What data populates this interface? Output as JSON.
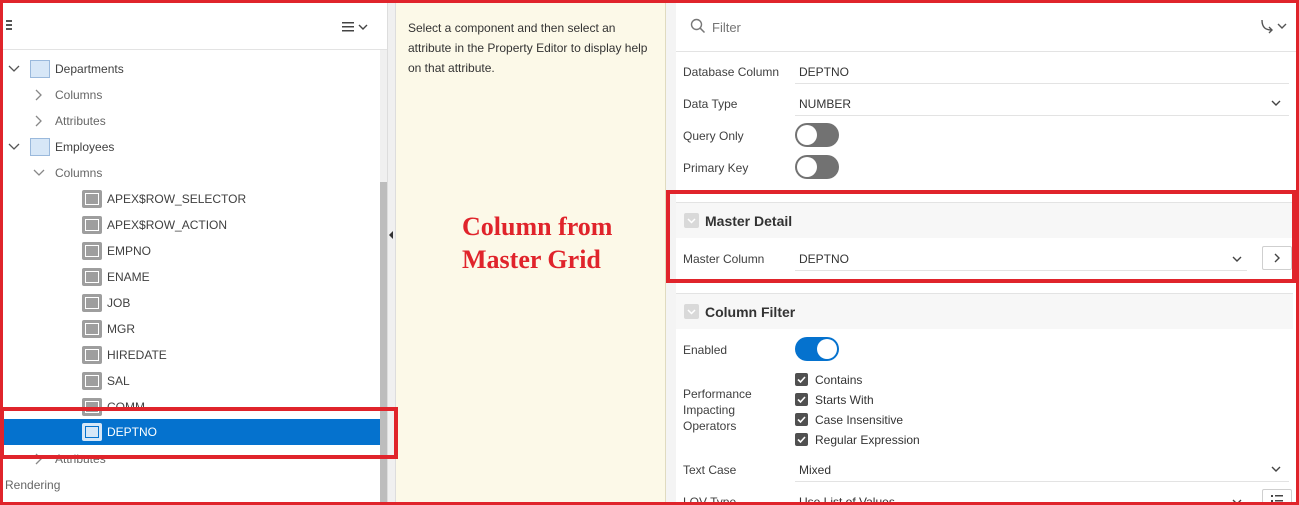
{
  "tree": {
    "items": [
      {
        "label": "Departments"
      },
      {
        "label": "Columns"
      },
      {
        "label": "Attributes"
      },
      {
        "label": "Employees"
      },
      {
        "label": "Columns"
      },
      {
        "label": "APEX$ROW_SELECTOR"
      },
      {
        "label": "APEX$ROW_ACTION"
      },
      {
        "label": "EMPNO"
      },
      {
        "label": "ENAME"
      },
      {
        "label": "JOB"
      },
      {
        "label": "MGR"
      },
      {
        "label": "HIREDATE"
      },
      {
        "label": "SAL"
      },
      {
        "label": "COMM"
      },
      {
        "label": "DEPTNO"
      },
      {
        "label": "Attributes"
      },
      {
        "label": "Rendering"
      }
    ],
    "selected": "DEPTNO"
  },
  "help": {
    "text": "Select a component and then select an attribute in the Property Editor to display help on that attribute."
  },
  "annotation": {
    "line1": "Column from",
    "line2": "Master Grid"
  },
  "property_editor": {
    "filter_placeholder": "Filter",
    "column": {
      "database_column_label": "Database Column",
      "database_column_value": "DEPTNO",
      "data_type_label": "Data Type",
      "data_type_value": "NUMBER",
      "query_only_label": "Query Only",
      "query_only_on": false,
      "primary_key_label": "Primary Key",
      "primary_key_on": false
    },
    "master_detail": {
      "title": "Master Detail",
      "master_column_label": "Master Column",
      "master_column_value": "DEPTNO"
    },
    "column_filter": {
      "title": "Column Filter",
      "enabled_label": "Enabled",
      "enabled_on": true,
      "perf_label_1": "Performance",
      "perf_label_2": "Impacting",
      "perf_label_3": "Operators",
      "operators": [
        "Contains",
        "Starts With",
        "Case Insensitive",
        "Regular Expression"
      ],
      "text_case_label": "Text Case",
      "text_case_value": "Mixed",
      "lov_type_label": "LOV Type",
      "lov_type_value": "Use List of Values"
    }
  },
  "colors": {
    "selection": "#0572ce",
    "annotation_red": "#e0242b",
    "help_bg": "#fcf9e8"
  }
}
